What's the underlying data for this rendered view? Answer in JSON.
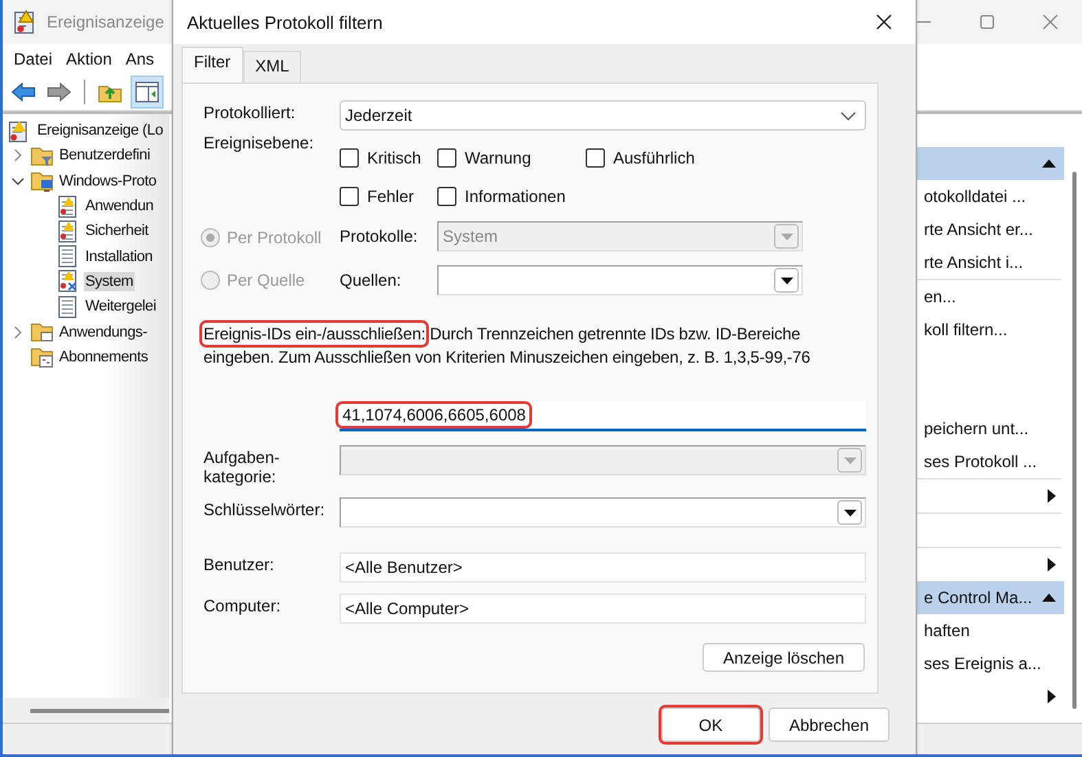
{
  "window": {
    "title": "Ereignisanzeige"
  },
  "menu": [
    "Datei",
    "Aktion",
    "Ans"
  ],
  "tree": [
    {
      "label": "Ereignisanzeige (Lo",
      "kind": "viewer",
      "selected": false,
      "children": [
        {
          "label": "Benutzerdefini",
          "kind": "filter-folder",
          "expanded": false,
          "selected": false
        },
        {
          "label": "Windows-Proto",
          "kind": "pc-folder",
          "expanded": true,
          "selected": false,
          "children": [
            {
              "label": "Anwendun",
              "kind": "warn-log",
              "selected": false
            },
            {
              "label": "Sicherheit",
              "kind": "warn-log",
              "selected": false
            },
            {
              "label": "Installation",
              "kind": "log",
              "selected": false
            },
            {
              "label": "System",
              "kind": "error-log",
              "selected": true
            },
            {
              "label": "Weitergelei",
              "kind": "log",
              "selected": false
            }
          ]
        },
        {
          "label": "Anwendungs-",
          "kind": "folder",
          "expanded": false,
          "selected": false
        },
        {
          "label": "Abonnements",
          "kind": "sub-folder",
          "selected": false
        }
      ]
    }
  ],
  "actions": [
    {
      "expanded": true,
      "items": [
        {
          "kind": "action",
          "label": "otokolldatei ..."
        },
        {
          "kind": "action",
          "label": "rte Ansicht er..."
        },
        {
          "kind": "action",
          "label": "rte Ansicht i..."
        },
        {
          "kind": "separator"
        },
        {
          "kind": "action",
          "label": "en..."
        },
        {
          "kind": "action",
          "label": "koll filtern..."
        },
        {
          "kind": "action"
        },
        {
          "kind": "action"
        },
        {
          "kind": "action",
          "label": "peichern unt..."
        },
        {
          "kind": "action",
          "label": "ses Protokoll ..."
        },
        {
          "kind": "separator"
        },
        {
          "kind": "action",
          "submenu": true
        },
        {
          "kind": "separator"
        },
        {
          "kind": "action"
        },
        {
          "kind": "separator"
        },
        {
          "kind": "action",
          "submenu": true
        }
      ]
    },
    {
      "title": "e Control Ma...",
      "expanded": true,
      "items": [
        {
          "kind": "action",
          "label": "haften"
        },
        {
          "kind": "action",
          "label": "ses Ereignis a..."
        },
        {
          "kind": "action",
          "submenu": true
        }
      ]
    }
  ],
  "dialog": {
    "title": "Aktuelles Protokoll filtern",
    "tabs": [
      {
        "label": "Filter",
        "selected": true
      },
      {
        "label": "XML",
        "selected": false
      }
    ],
    "logged": {
      "label": "Protokolliert:",
      "value": "Jederzeit"
    },
    "event_level": {
      "label": "Ereignisebene:",
      "options": [
        {
          "label": "Kritisch",
          "checked": false
        },
        {
          "label": "Warnung",
          "checked": false
        },
        {
          "label": "Ausführlich",
          "checked": false
        },
        {
          "label": "Fehler",
          "checked": false
        },
        {
          "label": "Informationen",
          "checked": false
        }
      ]
    },
    "source_mode": [
      {
        "label": "Per Protokoll",
        "selected": true,
        "disabled": true
      },
      {
        "label": "Per Quelle",
        "selected": false,
        "disabled": true
      }
    ],
    "logs": {
      "label": "Protokolle:",
      "value": "System",
      "disabled": true
    },
    "sources": {
      "label": "Quellen:",
      "disabled": false
    },
    "event_ids": {
      "label": "Ereignis-IDs ein-/ausschließen:",
      "label_highlighted": true,
      "hint": "Durch Trennzeichen getrennte IDs bzw. ID-Bereiche eingeben. Zum Ausschließen von Kriterien Minuszeichen eingeben, z. B. 1,3,5-99,-76",
      "value": "41,1074,6006,6605,6008",
      "value_highlighted": true
    },
    "task_category": {
      "label": "Aufgaben-kategorie:",
      "disabled": true
    },
    "keywords": {
      "label": "Schlüsselwörter:",
      "disabled": false
    },
    "user": {
      "label": "Benutzer:",
      "value": "<Alle Benutzer>"
    },
    "computer": {
      "label": "Computer:",
      "value": "<Alle Computer>"
    },
    "clear_button": "Anzeige löschen",
    "buttons": [
      {
        "label": "OK",
        "highlighted": true
      },
      {
        "label": "Abbrechen",
        "highlighted": false
      }
    ]
  }
}
